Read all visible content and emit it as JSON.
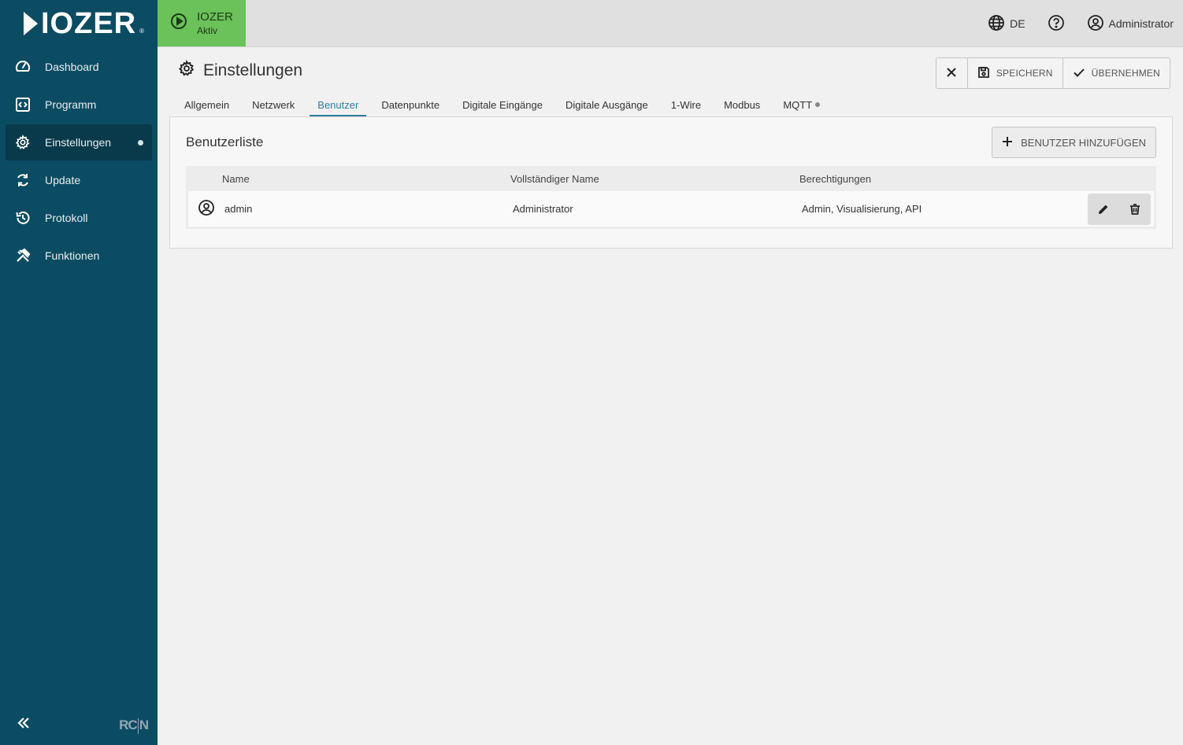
{
  "app": {
    "logo_text": "IOZER",
    "logo_trademark": "®",
    "vendor_logo_left": "RC",
    "vendor_logo_right": "N"
  },
  "sidebar": {
    "items": [
      {
        "label": "Dashboard",
        "icon": "speedometer-icon"
      },
      {
        "label": "Programm",
        "icon": "code-icon"
      },
      {
        "label": "Einstellungen",
        "icon": "gear-icon"
      },
      {
        "label": "Update",
        "icon": "refresh-icon"
      },
      {
        "label": "Protokoll",
        "icon": "history-icon"
      },
      {
        "label": "Funktionen",
        "icon": "tools-icon"
      }
    ],
    "active_index": 2
  },
  "topbar": {
    "status_title": "IOZER",
    "status_sub": "Aktiv",
    "status_color": "#6bc15a",
    "language": "DE",
    "user": "Administrator"
  },
  "page": {
    "title": "Einstellungen",
    "actions": {
      "save_label": "SPEICHERN",
      "apply_label": "ÜBERNEHMEN"
    }
  },
  "tabs": [
    {
      "label": "Allgemein"
    },
    {
      "label": "Netzwerk"
    },
    {
      "label": "Benutzer"
    },
    {
      "label": "Datenpunkte"
    },
    {
      "label": "Digitale Eingänge"
    },
    {
      "label": "Digitale Ausgänge"
    },
    {
      "label": "1-Wire"
    },
    {
      "label": "Modbus"
    },
    {
      "label": "MQTT"
    }
  ],
  "active_tab": "Benutzer",
  "user_list": {
    "title": "Benutzerliste",
    "add_label": "BENUTZER HINZUFÜGEN",
    "columns": [
      "Name",
      "Vollständiger Name",
      "Berechtigungen"
    ],
    "rows": [
      {
        "name": "admin",
        "full_name": "Administrator",
        "permissions": "Admin, Visualisierung, API"
      }
    ]
  },
  "colors": {
    "sidebar": "#0c4c62",
    "accent": "#2e7ea0"
  }
}
